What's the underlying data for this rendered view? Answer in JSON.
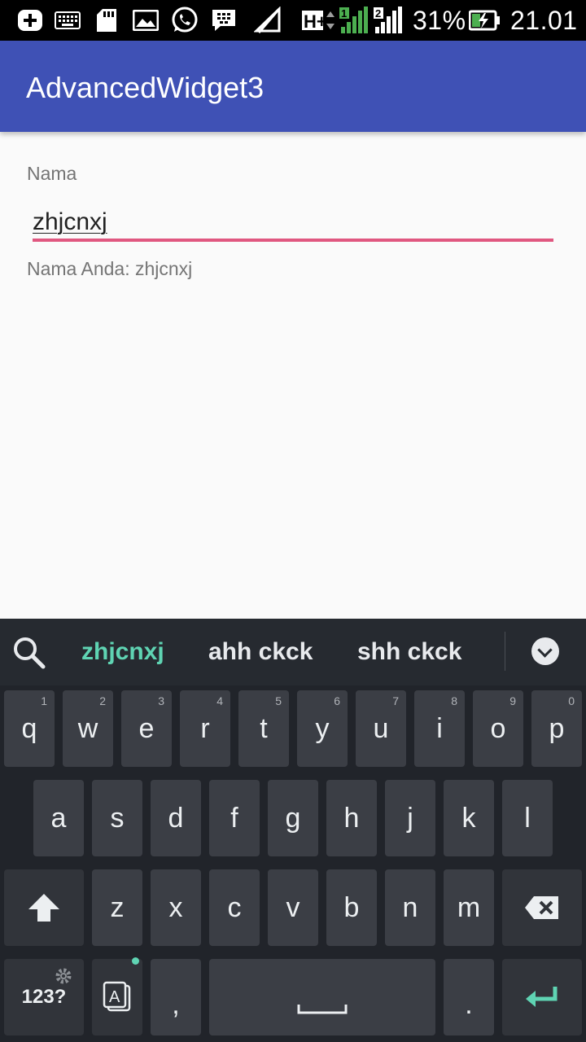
{
  "status_bar": {
    "battery_percent": "31%",
    "time": "21.01",
    "network": "H+",
    "sim1": "1",
    "sim2": "2",
    "icons": [
      "add-icon",
      "keyboard-icon",
      "sd-card-icon",
      "gallery-icon",
      "whatsapp-icon",
      "bbm-icon",
      "no-wifi-icon",
      "signal-icon",
      "battery-charging-icon"
    ]
  },
  "app_bar": {
    "title": "AdvancedWidget3",
    "color": "#3f51b5"
  },
  "form": {
    "label": "Nama",
    "input_value": "zhjcnxj",
    "accent": "#e05780",
    "result": "Nama Anda: zhjcnxj"
  },
  "keyboard": {
    "suggestions": [
      "zhjcnxj",
      "ahh ckck",
      "shh ckck"
    ],
    "row1": [
      {
        "k": "q",
        "h": "1"
      },
      {
        "k": "w",
        "h": "2"
      },
      {
        "k": "e",
        "h": "3"
      },
      {
        "k": "r",
        "h": "4"
      },
      {
        "k": "t",
        "h": "5"
      },
      {
        "k": "y",
        "h": "6"
      },
      {
        "k": "u",
        "h": "7"
      },
      {
        "k": "i",
        "h": "8"
      },
      {
        "k": "o",
        "h": "9"
      },
      {
        "k": "p",
        "h": "0"
      }
    ],
    "row2": [
      "a",
      "s",
      "d",
      "f",
      "g",
      "h",
      "j",
      "k",
      "l"
    ],
    "row3": [
      "z",
      "x",
      "c",
      "v",
      "b",
      "n",
      "m"
    ],
    "symbols_label": "123?",
    "comma": ",",
    "period": "."
  }
}
